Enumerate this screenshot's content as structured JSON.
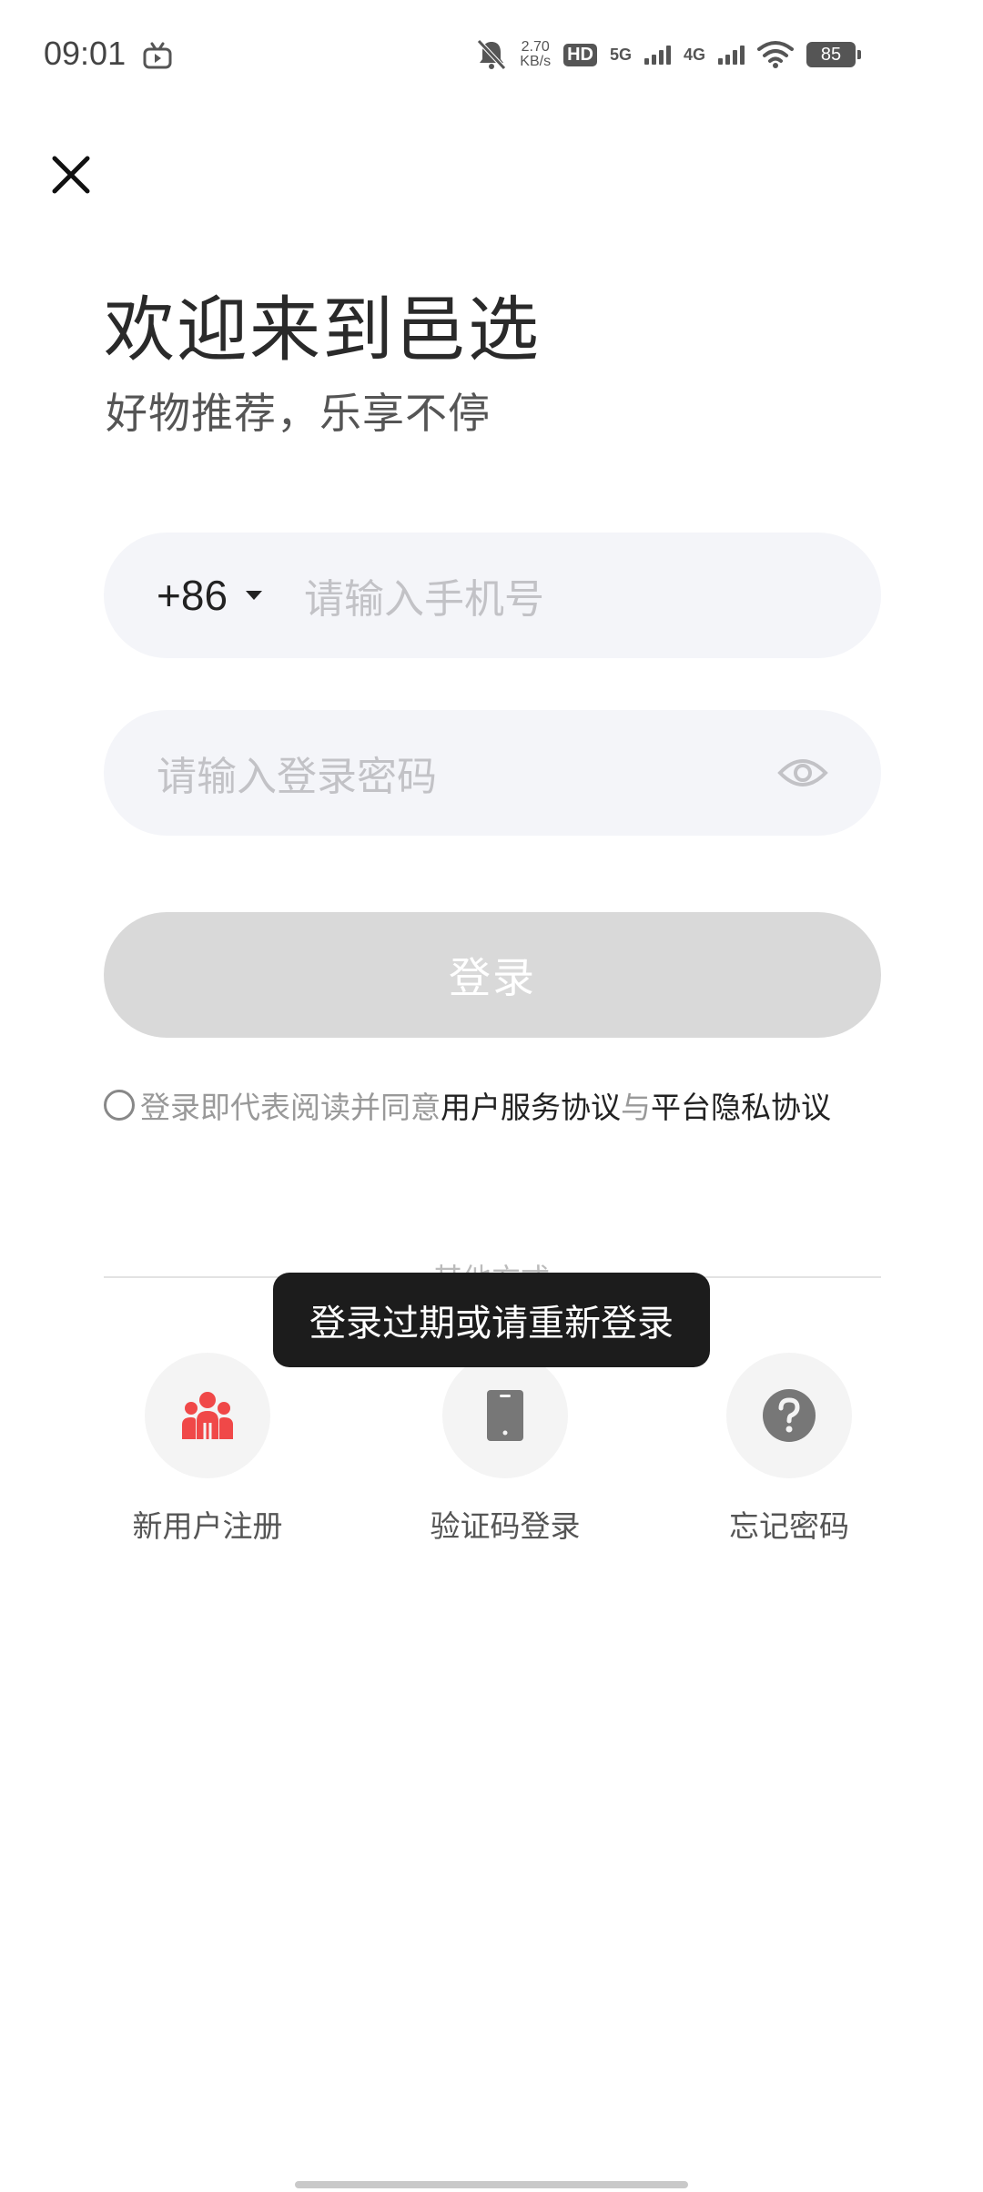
{
  "status_bar": {
    "time": "09:01",
    "net_speed_value": "2.70",
    "net_speed_unit": "KB/s",
    "hd_label": "HD",
    "sim1_label": "5G",
    "sim2_label": "4G",
    "battery": "85",
    "icons": [
      "tv-icon",
      "mute-bell-icon",
      "signal-icon",
      "wifi-icon",
      "battery-icon"
    ]
  },
  "header": {
    "title": "欢迎来到邑选",
    "subtitle": "好物推荐，乐享不停"
  },
  "form": {
    "country_code": "+86",
    "phone_placeholder": "请输入手机号",
    "password_placeholder": "请输入登录密码",
    "login_label": "登录"
  },
  "agreement": {
    "prefix": "登录即代表阅读并同意",
    "terms": "用户服务协议",
    "conjunction": "与",
    "privacy": "平台隐私协议"
  },
  "other_methods": {
    "divider_label": "其他方式",
    "options": [
      {
        "label": "新用户注册",
        "icon": "new-user-icon",
        "color": "#f04848"
      },
      {
        "label": "验证码登录",
        "icon": "phone-icon",
        "color": "#777777"
      },
      {
        "label": "忘记密码",
        "icon": "question-icon",
        "color": "#777777"
      }
    ]
  },
  "toast": {
    "message": "登录过期或请重新登录"
  },
  "colors": {
    "field_bg": "#f4f5f9",
    "button_disabled": "#d9d9d9",
    "accent_red": "#f04848"
  }
}
